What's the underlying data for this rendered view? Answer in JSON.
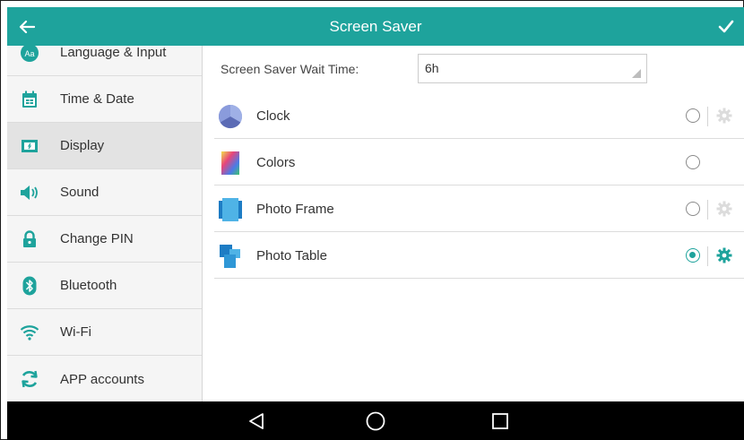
{
  "header": {
    "title": "Screen Saver",
    "back_icon": "arrow-left-icon",
    "confirm_icon": "checkmark-icon"
  },
  "sidebar": {
    "items": [
      {
        "label": "Language & Input",
        "icon": "language-icon",
        "active": false
      },
      {
        "label": "Time & Date",
        "icon": "calendar-icon",
        "active": false
      },
      {
        "label": "Display",
        "icon": "display-icon",
        "active": true
      },
      {
        "label": "Sound",
        "icon": "speaker-icon",
        "active": false
      },
      {
        "label": "Change PIN",
        "icon": "lock-icon",
        "active": false
      },
      {
        "label": "Bluetooth",
        "icon": "bluetooth-icon",
        "active": false
      },
      {
        "label": "Wi-Fi",
        "icon": "wifi-icon",
        "active": false
      },
      {
        "label": "APP accounts",
        "icon": "sync-icon",
        "active": false
      }
    ]
  },
  "main": {
    "wait_time": {
      "label": "Screen Saver Wait Time:",
      "value": "6h"
    },
    "screensavers": [
      {
        "label": "Clock",
        "icon": "clock-cube-icon",
        "selected": false,
        "has_settings": true
      },
      {
        "label": "Colors",
        "icon": "colors-gradient-icon",
        "selected": false,
        "has_settings": false
      },
      {
        "label": "Photo Frame",
        "icon": "photo-frame-icon",
        "selected": false,
        "has_settings": true
      },
      {
        "label": "Photo Table",
        "icon": "photo-table-icon",
        "selected": true,
        "has_settings": true
      }
    ]
  },
  "navbar": {
    "back_icon": "nav-back-triangle-icon",
    "home_icon": "nav-home-circle-icon",
    "recents_icon": "nav-recents-square-icon"
  },
  "colors": {
    "accent": "#1ea39c",
    "sidebar_bg": "#f5f5f5",
    "active_bg": "#e3e3e3",
    "navbar_bg": "#000000"
  }
}
